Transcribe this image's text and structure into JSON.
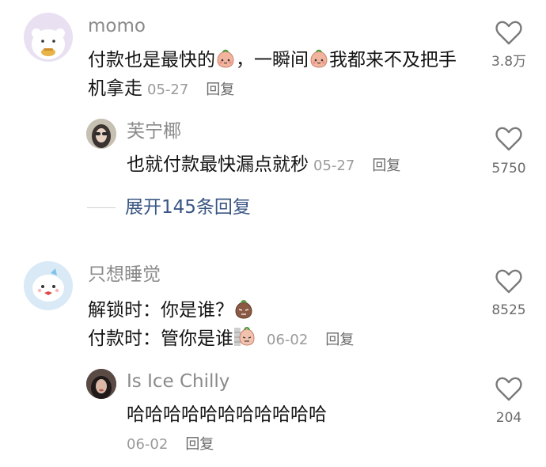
{
  "comments": [
    {
      "username": "momo",
      "parts": [
        "付款也是最快的",
        "，一瞬间",
        "我都来不及把手机拿走"
      ],
      "emoji_icon": "peach-face-icon",
      "date": "05-27",
      "reply_label": "回复",
      "likes": "3.8万",
      "replies": [
        {
          "username": "芙宁椰",
          "text": "也就付款最快漏点就秒",
          "date": "05-27",
          "reply_label": "回复",
          "likes": "5750"
        }
      ],
      "expand_label": "展开145条回复"
    },
    {
      "username": "只想睡觉",
      "line1": "解锁时：你是谁？",
      "line2": "付款时：管你是谁",
      "emoji_icons": [
        "suspicious-peach-icon",
        "peeking-peach-icon"
      ],
      "date": "06-02",
      "reply_label": "回复",
      "likes": "8525",
      "replies": [
        {
          "username": "Is Ice Chilly",
          "text": "哈哈哈哈哈哈哈哈哈哈哈",
          "date": "06-02",
          "reply_label": "回复",
          "likes": "204"
        }
      ]
    }
  ],
  "colors": {
    "username": "#8a8a8a",
    "text": "#141414",
    "meta": "#9a9a9a",
    "expand_link": "#3a5683",
    "icon_stroke": "#7a7a7a"
  }
}
